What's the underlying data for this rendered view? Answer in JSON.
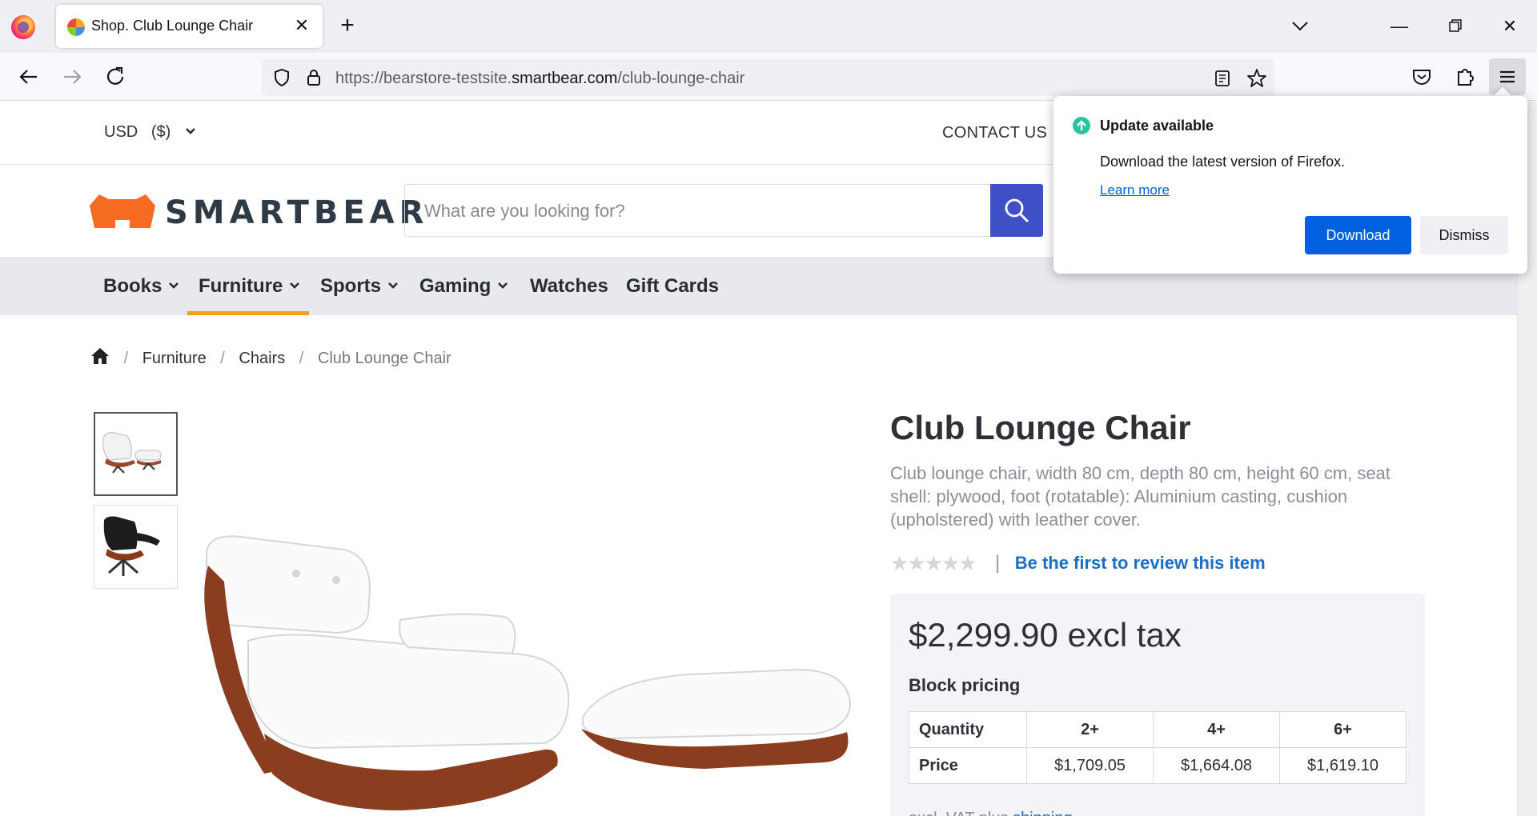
{
  "browser": {
    "tab_title": "Shop. Club Lounge Chair",
    "url_host_prefix": "https://bearstore-testsite.",
    "url_domain": "smartbear.com",
    "url_path": "/club-lounge-chair",
    "icons": {
      "back": "arrow-left-icon",
      "forward": "arrow-right-icon",
      "reload": "reload-icon",
      "tracking": "shield-icon",
      "lock": "lock-icon",
      "reader": "reader-view-icon",
      "bookmark": "star-icon",
      "pocket": "pocket-icon",
      "extensions": "puzzle-icon",
      "menu": "hamburger-menu-icon"
    }
  },
  "update_popup": {
    "title": "Update available",
    "message": "Download the latest version of Firefox.",
    "learn_more": "Learn more",
    "download": "Download",
    "dismiss": "Dismiss"
  },
  "store": {
    "currency": "USD   ($)",
    "contact": "CONTACT US",
    "logo_text": "SMARTBEAR",
    "search_placeholder": "What are you looking for?",
    "nav": [
      "Books",
      "Furniture",
      "Sports",
      "Gaming",
      "Watches",
      "Gift Cards"
    ],
    "active_nav": "Furniture",
    "brand_color": "#f46b21",
    "accent_color": "#3f4fc6"
  },
  "breadcrumb": {
    "items": [
      "Furniture",
      "Chairs"
    ],
    "current": "Club Lounge Chair"
  },
  "product": {
    "title": "Club Lounge Chair",
    "description": "Club lounge chair, width 80 cm, depth 80 cm, height 60 cm, seat shell: plywood, foot (rotatable): Aluminium casting, cushion (upholstered) with leather cover.",
    "rating_stars": 0,
    "rating_max": 5,
    "review_link": "Be the first to review this item",
    "price": "$2,299.90 excl tax",
    "block_pricing_label": "Block pricing",
    "block_table": {
      "row_labels": [
        "Quantity",
        "Price"
      ],
      "quantities": [
        "2+",
        "4+",
        "6+"
      ],
      "prices": [
        "$1,709.05",
        "$1,664.08",
        "$1,619.10"
      ]
    },
    "tax_note_prefix": "excl. VAT plus",
    "tax_note_link": "shipping"
  }
}
